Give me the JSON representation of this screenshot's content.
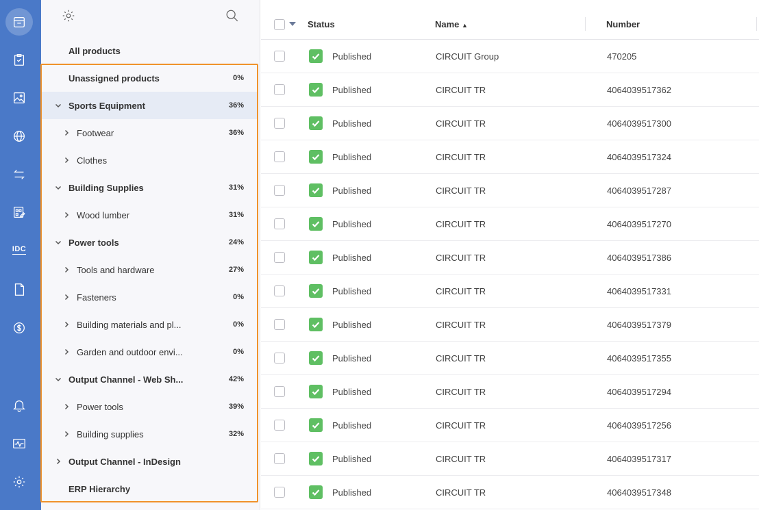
{
  "tree": {
    "all_products": "All products",
    "items": [
      {
        "label": "Unassigned products",
        "pct": "0%",
        "level": 0,
        "bold": true,
        "chevron": "none",
        "selected": false
      },
      {
        "label": "Sports Equipment",
        "pct": "36%",
        "level": 0,
        "bold": true,
        "chevron": "down",
        "selected": true
      },
      {
        "label": "Footwear",
        "pct": "36%",
        "level": 1,
        "bold": false,
        "chevron": "right",
        "selected": false
      },
      {
        "label": "Clothes",
        "pct": "",
        "level": 1,
        "bold": false,
        "chevron": "right",
        "selected": false
      },
      {
        "label": "Building Supplies",
        "pct": "31%",
        "level": 0,
        "bold": true,
        "chevron": "down",
        "selected": false
      },
      {
        "label": "Wood lumber",
        "pct": "31%",
        "level": 1,
        "bold": false,
        "chevron": "right",
        "selected": false
      },
      {
        "label": "Power tools",
        "pct": "24%",
        "level": 0,
        "bold": true,
        "chevron": "down",
        "selected": false
      },
      {
        "label": "Tools and hardware",
        "pct": "27%",
        "level": 1,
        "bold": false,
        "chevron": "right",
        "selected": false
      },
      {
        "label": "Fasteners",
        "pct": "0%",
        "level": 1,
        "bold": false,
        "chevron": "right",
        "selected": false
      },
      {
        "label": "Building materials and pl...",
        "pct": "0%",
        "level": 1,
        "bold": false,
        "chevron": "right",
        "selected": false
      },
      {
        "label": "Garden and outdoor envi...",
        "pct": "0%",
        "level": 1,
        "bold": false,
        "chevron": "right",
        "selected": false
      },
      {
        "label": "Output Channel - Web Sh...",
        "pct": "42%",
        "level": 0,
        "bold": true,
        "chevron": "down",
        "selected": false
      },
      {
        "label": "Power tools",
        "pct": "39%",
        "level": 1,
        "bold": false,
        "chevron": "right",
        "selected": false
      },
      {
        "label": "Building supplies",
        "pct": "32%",
        "level": 1,
        "bold": false,
        "chevron": "right",
        "selected": false
      },
      {
        "label": "Output Channel - InDesign",
        "pct": "",
        "level": 0,
        "bold": true,
        "chevron": "right",
        "selected": false
      },
      {
        "label": "ERP Hierarchy",
        "pct": "",
        "level": 0,
        "bold": true,
        "chevron": "none",
        "selected": false
      }
    ]
  },
  "rail": {
    "icons": [
      "product-box-icon",
      "clipboard-check-icon",
      "image-icon",
      "globe-icon",
      "transfer-arrows-icon",
      "board-edit-icon",
      "idc-icon",
      "pdf-icon",
      "dollar-icon",
      "bell-icon",
      "activity-monitor-icon",
      "settings-gear-icon"
    ],
    "idc_label": "IDC",
    "pdf_label": "PDF"
  },
  "table": {
    "columns": {
      "status": "Status",
      "name": "Name",
      "number": "Number"
    },
    "sort_indicator": "▲",
    "rows": [
      {
        "status": "Published",
        "name": "CIRCUIT Group",
        "number": "470205"
      },
      {
        "status": "Published",
        "name": "CIRCUIT TR",
        "number": "4064039517362"
      },
      {
        "status": "Published",
        "name": "CIRCUIT TR",
        "number": "4064039517300"
      },
      {
        "status": "Published",
        "name": "CIRCUIT TR",
        "number": "4064039517324"
      },
      {
        "status": "Published",
        "name": "CIRCUIT TR",
        "number": "4064039517287"
      },
      {
        "status": "Published",
        "name": "CIRCUIT TR",
        "number": "4064039517270"
      },
      {
        "status": "Published",
        "name": "CIRCUIT TR",
        "number": "4064039517386"
      },
      {
        "status": "Published",
        "name": "CIRCUIT TR",
        "number": "4064039517331"
      },
      {
        "status": "Published",
        "name": "CIRCUIT TR",
        "number": "4064039517379"
      },
      {
        "status": "Published",
        "name": "CIRCUIT TR",
        "number": "4064039517355"
      },
      {
        "status": "Published",
        "name": "CIRCUIT TR",
        "number": "4064039517294"
      },
      {
        "status": "Published",
        "name": "CIRCUIT TR",
        "number": "4064039517256"
      },
      {
        "status": "Published",
        "name": "CIRCUIT TR",
        "number": "4064039517317"
      },
      {
        "status": "Published",
        "name": "CIRCUIT TR",
        "number": "4064039517348"
      }
    ]
  },
  "colors": {
    "rail": "#4a79c8",
    "published_green": "#5fbf63",
    "highlight_orange": "#f0922b",
    "selected_row": "#e6ebf5"
  }
}
